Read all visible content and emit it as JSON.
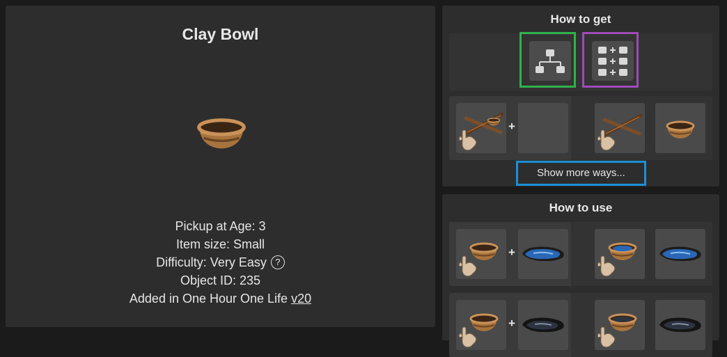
{
  "item": {
    "title": "Clay Bowl",
    "pickup": "Pickup at Age: 3",
    "size": "Item size: Small",
    "difficulty": "Difficulty: Very Easy",
    "help": "?",
    "object_id": "Object ID: 235",
    "added_prefix": "Added in One Hour One Life ",
    "version": "v20"
  },
  "how_to_get": {
    "title": "How to get",
    "show_more": "Show more ways..."
  },
  "how_to_use": {
    "title": "How to use"
  },
  "plus": "+",
  "colors": {
    "tree_view_highlight": "#2fb24e",
    "tech_tree_highlight": "#9e4bb8",
    "show_more_highlight": "#1b8fd6"
  },
  "icons": {
    "tree_view": "hierarchy-icon",
    "recipe_grid": "grid-plus-icon",
    "hand": "hand-icon",
    "bowl": "clay-bowl-icon",
    "sticks": "sticks-icon",
    "water": "water-pond-icon",
    "dark_water": "dark-pond-icon"
  }
}
